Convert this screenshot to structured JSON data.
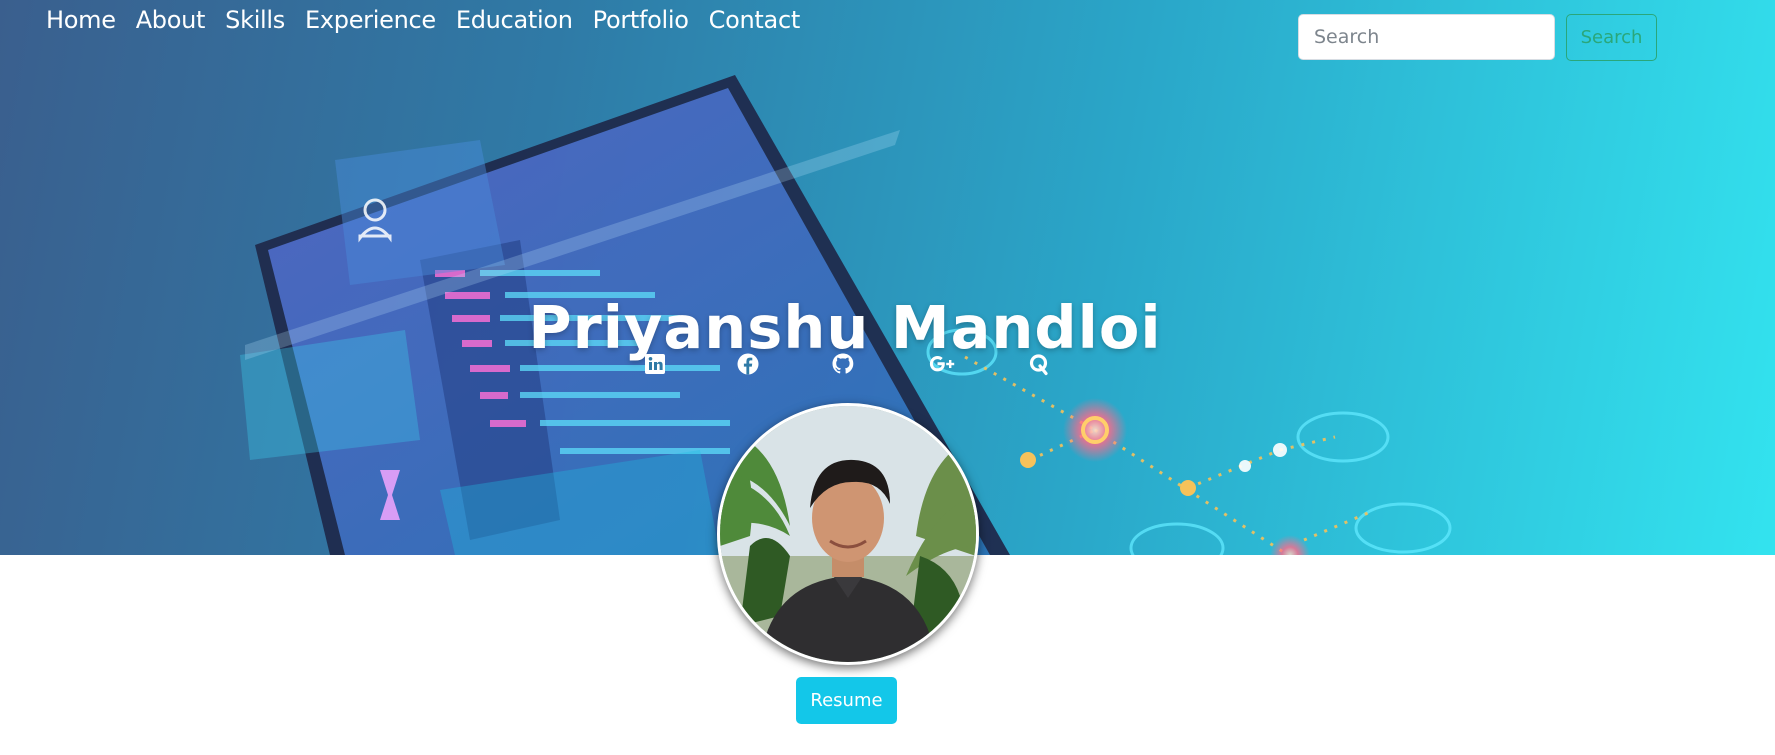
{
  "nav": {
    "items": [
      {
        "label": "Home"
      },
      {
        "label": "About"
      },
      {
        "label": "Skills"
      },
      {
        "label": "Experience"
      },
      {
        "label": "Education"
      },
      {
        "label": "Portfolio"
      },
      {
        "label": "Contact"
      }
    ]
  },
  "search": {
    "placeholder": "Search",
    "button_label": "Search"
  },
  "hero": {
    "name": "Priyanshu Mandloi"
  },
  "social": {
    "icons": [
      "linkedin-icon",
      "facebook-icon",
      "github-icon",
      "google-plus-icon",
      "quora-icon"
    ]
  },
  "resume": {
    "button_label": "Resume"
  },
  "colors": {
    "hero_gradient_start": "#3a5f8e",
    "hero_gradient_end": "#33e3ef",
    "search_button": "#2aa77a",
    "resume_button": "#13c7e9"
  }
}
